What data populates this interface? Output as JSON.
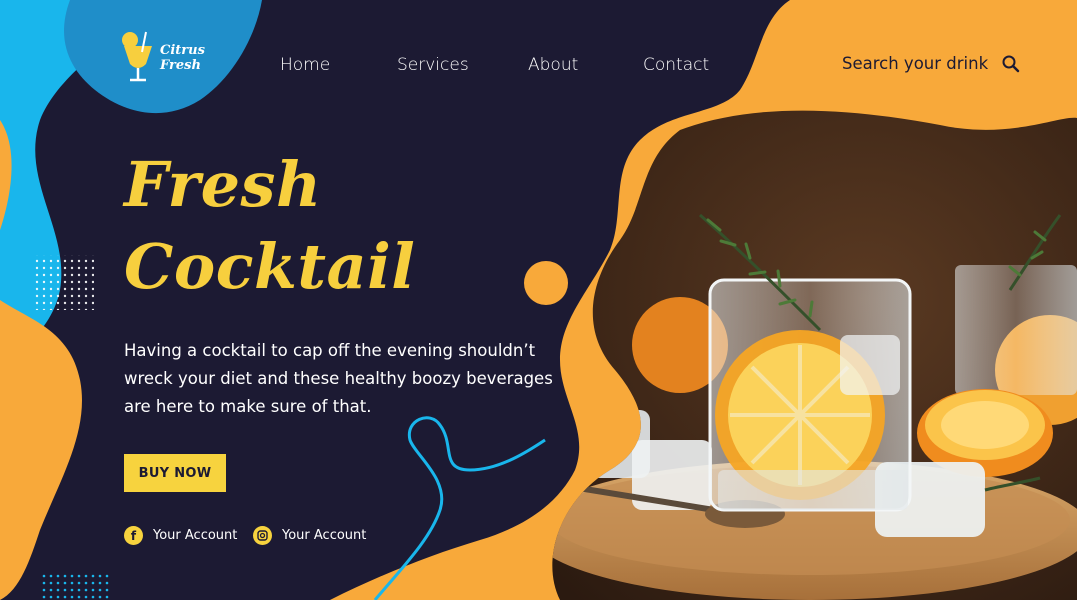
{
  "brand": {
    "name_line1": "Citrus",
    "name_line2": "Fresh",
    "icon": "cocktail-glass-icon"
  },
  "nav": {
    "items": [
      {
        "label": "Home"
      },
      {
        "label": "Services"
      },
      {
        "label": "About"
      },
      {
        "label": "Contact"
      }
    ]
  },
  "search": {
    "label": "Search your drink",
    "icon": "search-icon"
  },
  "hero": {
    "title_line1": "Fresh",
    "title_line2": "Cocktail",
    "description": "Having a cocktail to cap off the evening shouldn’t wreck your diet and these healthy boozy beverages are here to make sure of that.",
    "cta_label": "BUY NOW"
  },
  "social": [
    {
      "label": "Your Account",
      "icon": "facebook-icon"
    },
    {
      "label": "Your Account",
      "icon": "instagram-icon"
    }
  ],
  "colors": {
    "background": "#1c1a33",
    "accent_orange": "#f8a93a",
    "accent_yellow": "#f7cf3e",
    "accent_blue": "#2a9fd6",
    "accent_cyan": "#19b6ec"
  }
}
